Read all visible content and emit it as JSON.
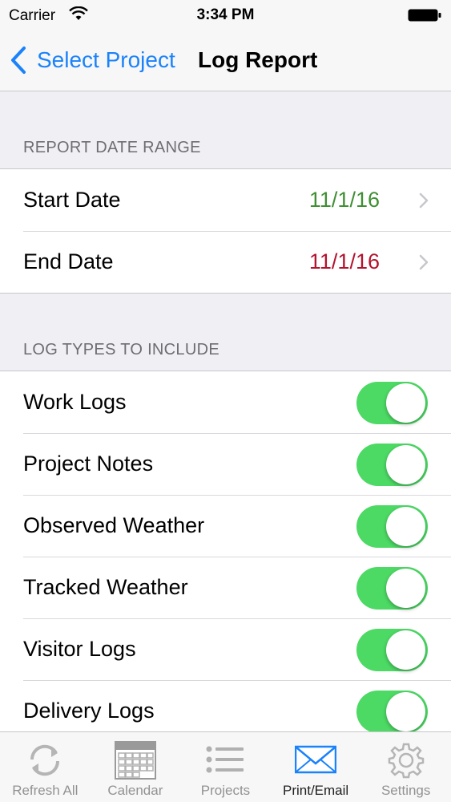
{
  "status_bar": {
    "carrier": "Carrier",
    "time": "3:34 PM"
  },
  "nav": {
    "back_label": "Select Project",
    "title": "Log Report"
  },
  "date_range": {
    "header": "REPORT DATE RANGE",
    "rows": [
      {
        "label": "Start Date",
        "value": "11/1/16",
        "color": "#3f8f33"
      },
      {
        "label": "End Date",
        "value": "11/1/16",
        "color": "#b3132d"
      }
    ]
  },
  "log_types": {
    "header": "LOG TYPES TO INCLUDE",
    "rows": [
      {
        "label": "Work Logs",
        "on": true
      },
      {
        "label": "Project Notes",
        "on": true
      },
      {
        "label": "Observed Weather",
        "on": true
      },
      {
        "label": "Tracked Weather",
        "on": true
      },
      {
        "label": "Visitor Logs",
        "on": true
      },
      {
        "label": "Delivery Logs",
        "on": true
      }
    ]
  },
  "tab_bar": {
    "tabs": [
      {
        "label": "Refresh All",
        "icon": "refresh-icon"
      },
      {
        "label": "Calendar",
        "icon": "calendar-icon"
      },
      {
        "label": "Projects",
        "icon": "list-icon"
      },
      {
        "label": "Print/Email",
        "icon": "envelope-icon",
        "active": true
      },
      {
        "label": "Settings",
        "icon": "gear-icon"
      }
    ]
  },
  "colors": {
    "accent": "#1a82fb",
    "toggle_on": "#4cd964",
    "start_date": "#3f8f33",
    "end_date": "#b3132d"
  }
}
